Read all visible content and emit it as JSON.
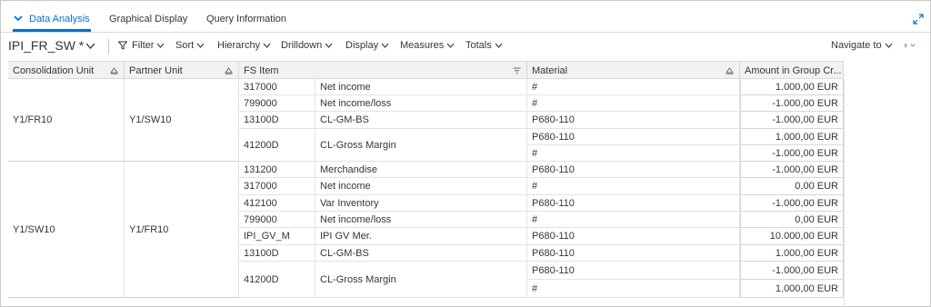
{
  "tabs": [
    {
      "label": "Data Analysis",
      "active": true
    },
    {
      "label": "Graphical Display",
      "active": false
    },
    {
      "label": "Query Information",
      "active": false
    }
  ],
  "toolbar": {
    "query_name": "IPI_FR_SW *",
    "filter": "Filter",
    "sort": "Sort",
    "hierarchy": "Hierarchy",
    "drilldown": "Drilldown",
    "display": "Display",
    "measures": "Measures",
    "totals": "Totals",
    "navigate_to": "Navigate to"
  },
  "table": {
    "columns": [
      "Consolidation Unit",
      "Partner Unit",
      "FS Item",
      "Material",
      "Amount in Group Cr..."
    ],
    "groups": [
      {
        "consolidation_unit": "Y1/FR10",
        "partner_unit": "Y1/SW10"
      },
      {
        "consolidation_unit": "Y1/SW10",
        "partner_unit": "Y1/FR10"
      }
    ],
    "fs_items": [
      {
        "code": "317000",
        "text": "Net income"
      },
      {
        "code": "799000",
        "text": "Net income/loss"
      },
      {
        "code": "13100D",
        "text": "CL-GM-BS"
      },
      {
        "code": "41200D",
        "text": "CL-Gross Margin"
      },
      {
        "code": "131200",
        "text": "Merchandise"
      },
      {
        "code": "317000",
        "text": "Net income"
      },
      {
        "code": "412100",
        "text": "Var Inventory"
      },
      {
        "code": "799000",
        "text": "Net income/loss"
      },
      {
        "code": "IPI_GV_M",
        "text": "IPI GV Mer."
      },
      {
        "code": "13100D",
        "text": "CL-GM-BS"
      },
      {
        "code": "41200D",
        "text": "CL-Gross Margin"
      }
    ],
    "materials": [
      "#",
      "#",
      "P680-110",
      "P680-110",
      "#",
      "P680-110",
      "#",
      "P680-110",
      "#",
      "P680-110",
      "P680-110",
      "P680-110",
      "P680-110",
      "#"
    ],
    "amounts": [
      "1.000,00 EUR",
      "-1.000,00 EUR",
      "-1.000,00 EUR",
      "1.000,00 EUR",
      "-1.000,00 EUR",
      "-1.000,00 EUR",
      "0,00 EUR",
      "-1.000,00 EUR",
      "0,00 EUR",
      "10.000,00 EUR",
      "1.000,00 EUR",
      "-1.000,00 EUR",
      "1.000,00 EUR"
    ]
  },
  "colors": {
    "accent": "#0a6ed1",
    "header_bg": "#f2f2f2",
    "border": "#d9d9d9",
    "text": "#32363a"
  }
}
